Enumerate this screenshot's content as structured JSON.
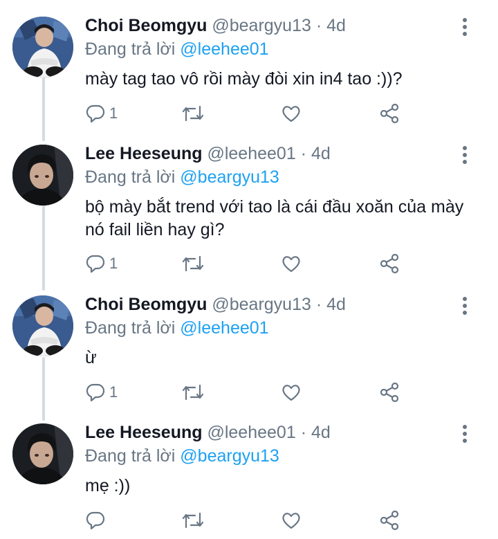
{
  "tweets": [
    {
      "name": "Choi Beomgyu",
      "handle": "@beargyu13",
      "dot": "·",
      "time": "4d",
      "reply_prefix": "Đang trả lời",
      "reply_mention": "@leehee01",
      "text": "mày tag tao vô rồi mày đòi xin in4 tao :))?",
      "reply_count": "1",
      "avatar": "avatar-beomgyu"
    },
    {
      "name": "Lee Heeseung",
      "handle": "@leehee01",
      "dot": "·",
      "time": "4d",
      "reply_prefix": "Đang trả lời",
      "reply_mention": "@beargyu13",
      "text": "bộ mày bắt trend với tao là cái đầu xoăn của mày nó fail liền hay gì?",
      "reply_count": "1",
      "avatar": "avatar-heeseung"
    },
    {
      "name": "Choi Beomgyu",
      "handle": "@beargyu13",
      "dot": "·",
      "time": "4d",
      "reply_prefix": "Đang trả lời",
      "reply_mention": "@leehee01",
      "text": "ừ",
      "reply_count": "1",
      "avatar": "avatar-beomgyu"
    },
    {
      "name": "Lee Heeseung",
      "handle": "@leehee01",
      "dot": "·",
      "time": "4d",
      "reply_prefix": "Đang trả lời",
      "reply_mention": "@beargyu13",
      "text": "mẹ :))",
      "reply_count": "",
      "avatar": "avatar-heeseung"
    }
  ],
  "icons": {
    "reply": "reply-icon",
    "retweet": "retweet-icon",
    "like": "heart-icon",
    "share": "share-icon",
    "more": "more-vertical-icon"
  },
  "colors": {
    "text": "#141823",
    "secondary": "#687684",
    "mention": "#1da1f2",
    "thread_line": "#d5dbe0"
  }
}
